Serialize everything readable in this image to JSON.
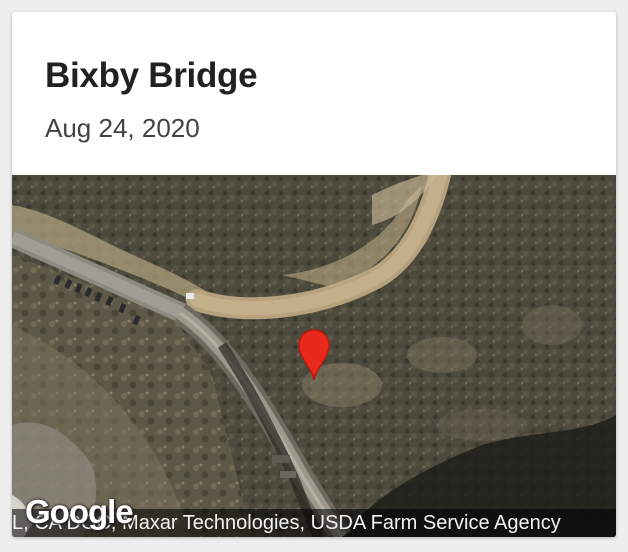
{
  "card": {
    "title": "Bixby Bridge",
    "date": "Aug 24, 2020"
  },
  "map": {
    "type": "satellite",
    "marker_icon": "map-pin-icon",
    "marker_color": "#e8291c",
    "logo_text": "Google",
    "attribution": "L, CA DOC, Maxar Technologies, USDA Farm Service Agency"
  }
}
